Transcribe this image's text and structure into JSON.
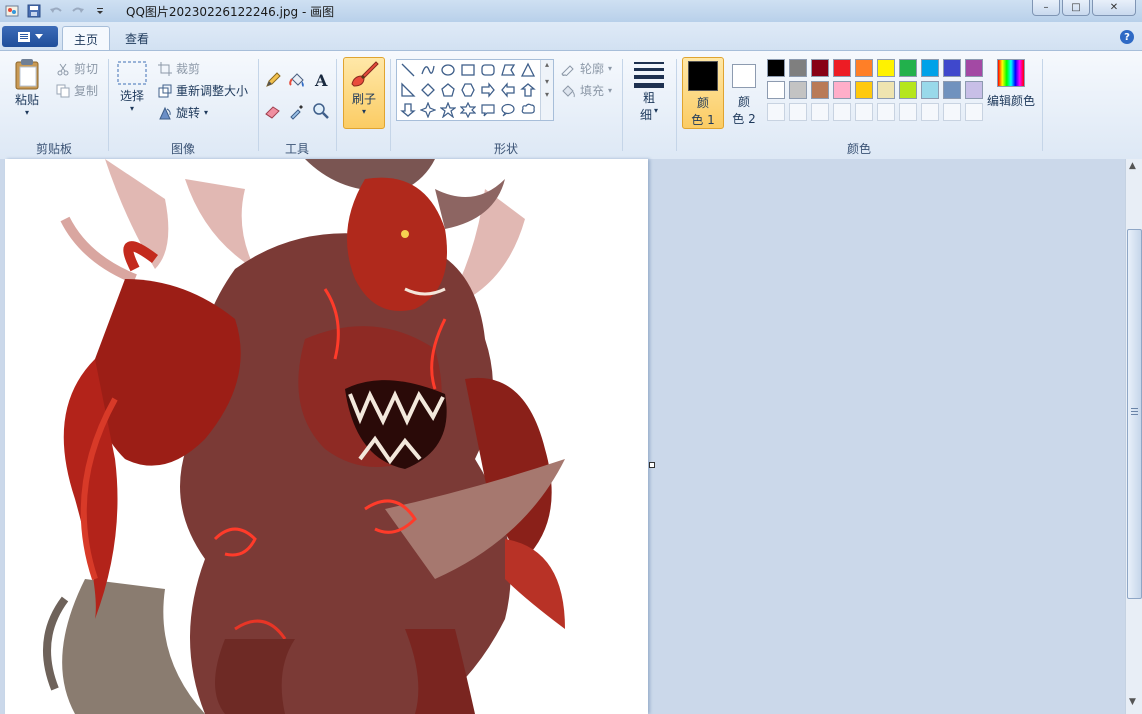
{
  "window": {
    "title": "QQ图片20230226122246.jpg - 画图",
    "controls": {
      "minimize": "–",
      "maximize": "□",
      "close": "✕"
    }
  },
  "quick_access": {
    "icons": [
      "paint-app-icon",
      "save-icon",
      "undo-icon",
      "redo-icon",
      "customize-dropdown-icon"
    ]
  },
  "tabs": [
    {
      "label": "主页",
      "active": true
    },
    {
      "label": "查看",
      "active": false
    }
  ],
  "help_label": "?",
  "ribbon": {
    "clipboard": {
      "label": "剪贴板",
      "paste": "粘贴",
      "cut": "剪切",
      "copy": "复制"
    },
    "image": {
      "label": "图像",
      "select": "选择",
      "crop": "裁剪",
      "resize": "重新调整大小",
      "rotate": "旋转"
    },
    "tools": {
      "label": "工具"
    },
    "brushes": {
      "label": "刷子"
    },
    "shapes": {
      "label": "形状",
      "outline": "轮廓",
      "fill": "填充"
    },
    "size": {
      "label_line1": "粗",
      "label_line2": "细"
    },
    "colors": {
      "label": "颜色",
      "color1_line1": "颜",
      "color1_line2": "色 1",
      "color2_line1": "颜",
      "color2_line2": "色 2",
      "edit": "编辑颜色",
      "color1_value": "#000000",
      "color2_value": "#ffffff",
      "palette_row1": [
        "#000000",
        "#7f7f7f",
        "#880015",
        "#ed1c24",
        "#ff7f27",
        "#fff200",
        "#22b14c",
        "#00a2e8",
        "#3f48cc",
        "#a349a4"
      ],
      "palette_row2": [
        "#ffffff",
        "#c3c3c3",
        "#b97a57",
        "#ffaec9",
        "#ffc90e",
        "#efe4b0",
        "#b5e61d",
        "#99d9ea",
        "#7092be",
        "#c8bfe7"
      ]
    }
  }
}
